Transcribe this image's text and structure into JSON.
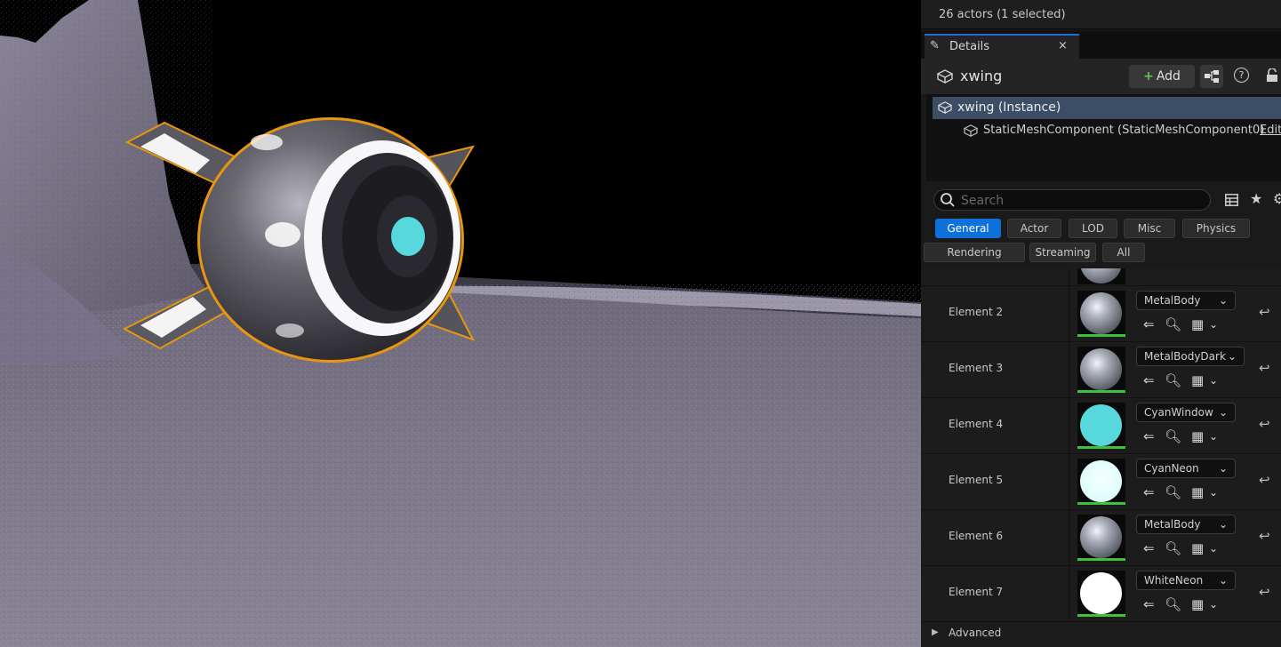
{
  "outliner": {
    "status": "26 actors (1 selected)"
  },
  "details_tab": {
    "label": "Details",
    "close": "×"
  },
  "actor": {
    "name": "xwing",
    "add_label": "Add"
  },
  "components": {
    "instance": "xwing (Instance)",
    "mesh": "StaticMeshComponent (StaticMeshComponent0)",
    "edit": "Edit"
  },
  "search": {
    "placeholder": "Search"
  },
  "filters": {
    "row1": [
      "General",
      "Actor",
      "LOD",
      "Misc",
      "Physics"
    ],
    "row2": [
      "Rendering",
      "Streaming",
      "All"
    ],
    "active": "General"
  },
  "materials": [
    {
      "element": "Element 2",
      "material": "MetalBody",
      "preview": "metal"
    },
    {
      "element": "Element 3",
      "material": "MetalBodyDark",
      "preview": "metal"
    },
    {
      "element": "Element 4",
      "material": "CyanWindow",
      "preview": "cyan"
    },
    {
      "element": "Element 5",
      "material": "CyanNeon",
      "preview": "pale-cyan"
    },
    {
      "element": "Element 6",
      "material": "MetalBody",
      "preview": "metal"
    },
    {
      "element": "Element 7",
      "material": "WhiteNeon",
      "preview": "white"
    }
  ],
  "advanced": {
    "label": "Advanced"
  },
  "colors": {
    "accent": "#0e70db",
    "selection": "#3b4e66",
    "selection_outline": "#e8950f",
    "cyan": "#56d8dc",
    "thumb_bar": "#3fc03a"
  },
  "icons": [
    "pencil-icon",
    "close-icon",
    "cube-icon",
    "plus-icon",
    "blueprint-icon",
    "help-icon",
    "lock-icon",
    "search-icon",
    "table-icon",
    "star-icon",
    "gear-icon",
    "chevron-down-icon",
    "use-selected-icon",
    "browse-icon",
    "checker-icon",
    "reset-arrow-icon",
    "expand-arrow-icon"
  ]
}
